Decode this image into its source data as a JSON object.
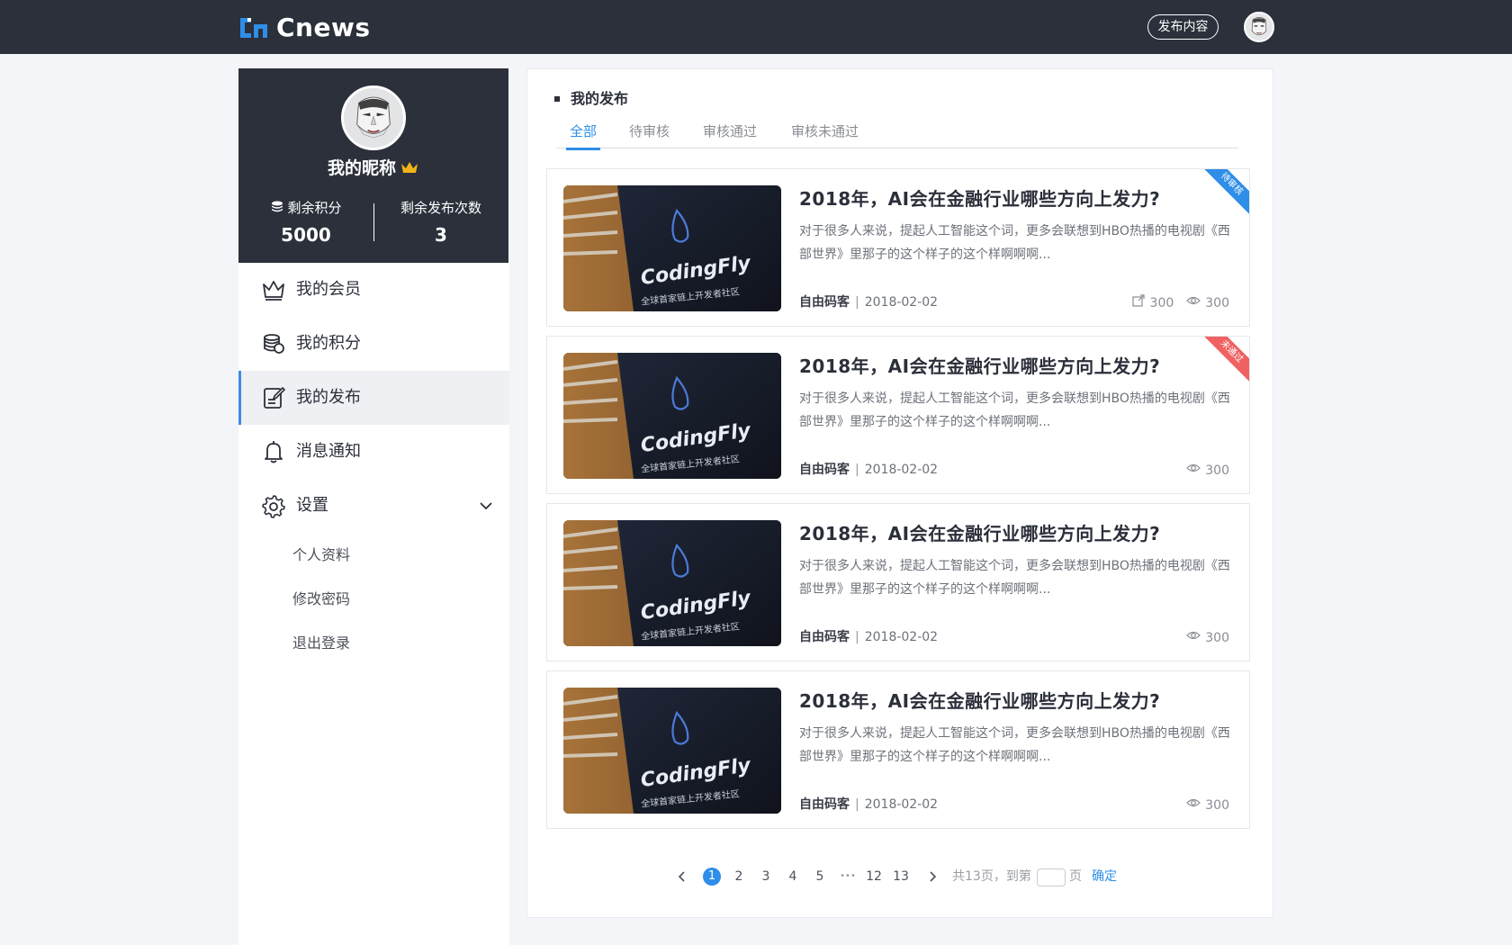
{
  "header": {
    "logo_text": "Cnews",
    "publish_button": "发布内容"
  },
  "profile": {
    "nickname": "我的昵称",
    "points_label": "剩余积分",
    "points_value": "5000",
    "publishes_label": "剩余发布次数",
    "publishes_value": "3"
  },
  "menu": {
    "items": [
      {
        "label": "我的会员",
        "icon": "crown-icon"
      },
      {
        "label": "我的积分",
        "icon": "coins-icon"
      },
      {
        "label": "我的发布",
        "icon": "edit-document-icon"
      },
      {
        "label": "消息通知",
        "icon": "bell-icon"
      },
      {
        "label": "设置",
        "icon": "gear-icon"
      }
    ],
    "settings_sub": [
      "个人资料",
      "修改密码",
      "退出登录"
    ]
  },
  "main": {
    "section_title": "我的发布",
    "tabs": [
      "全部",
      "待审核",
      "审核通过",
      "审核未通过"
    ]
  },
  "articles": [
    {
      "title": "2018年，AI会在金融行业哪些方向上发力?",
      "excerpt": "对于很多人来说，提起人工智能这个词，更多会联想到HBO热播的电视剧《西部世界》里那子的这个样子的这个样啊啊啊...",
      "author": "自由码客",
      "date": "2018-02-02",
      "shares": "300",
      "views": "300",
      "status": "待审核",
      "thumb_text": "CodingFly",
      "thumb_subtext": "全球首家链上开发者社区"
    },
    {
      "title": "2018年，AI会在金融行业哪些方向上发力?",
      "excerpt": "对于很多人来说，提起人工智能这个词，更多会联想到HBO热播的电视剧《西部世界》里那子的这个样子的这个样啊啊啊...",
      "author": "自由码客",
      "date": "2018-02-02",
      "views": "300",
      "status": "未通过",
      "thumb_text": "CodingFly",
      "thumb_subtext": "全球首家链上开发者社区"
    },
    {
      "title": "2018年，AI会在金融行业哪些方向上发力?",
      "excerpt": "对于很多人来说，提起人工智能这个词，更多会联想到HBO热播的电视剧《西部世界》里那子的这个样子的这个样啊啊啊...",
      "author": "自由码客",
      "date": "2018-02-02",
      "views": "300",
      "thumb_text": "CodingFly",
      "thumb_subtext": "全球首家链上开发者社区"
    },
    {
      "title": "2018年，AI会在金融行业哪些方向上发力?",
      "excerpt": "对于很多人来说，提起人工智能这个词，更多会联想到HBO热播的电视剧《西部世界》里那子的这个样子的这个样啊啊啊...",
      "author": "自由码客",
      "date": "2018-02-02",
      "views": "300",
      "thumb_text": "CodingFly",
      "thumb_subtext": "全球首家链上开发者社区"
    }
  ],
  "pagination": {
    "pages": [
      "1",
      "2",
      "3",
      "4",
      "5",
      "12",
      "13"
    ],
    "current": "1",
    "ellipsis": "•••",
    "total_text": "共13页，到第",
    "page_suffix": "页",
    "confirm": "确定"
  },
  "colors": {
    "accent": "#2e8ee8",
    "header_bg": "#2b303b",
    "rejected": "#f06262",
    "crown": "#f2b318"
  }
}
